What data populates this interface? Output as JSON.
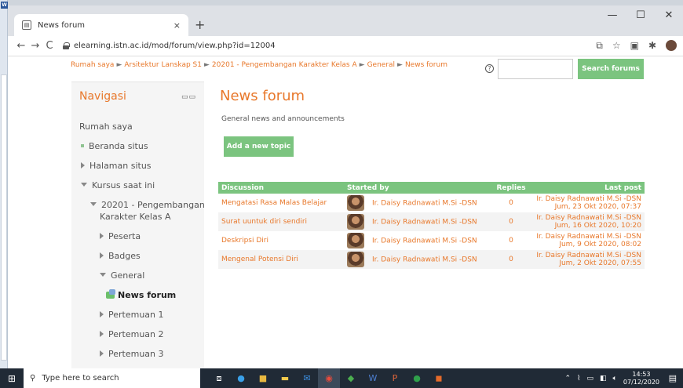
{
  "browser": {
    "tab_title": "News forum",
    "tab_close": "×",
    "new_tab": "+",
    "minimize": "—",
    "maximize": "☐",
    "close": "✕",
    "back": "←",
    "forward": "→",
    "reload": "C",
    "url": "elearning.istn.ac.id/mod/forum/view.php?id=12004"
  },
  "breadcrumb": [
    "Rumah saya",
    "Arsitektur Lanskap S1",
    "20201 - Pengembangan Karakter Kelas A",
    "General",
    "News forum"
  ],
  "breadcrumb_sep": "►",
  "search": {
    "button_label": "Search forums",
    "placeholder": ""
  },
  "sidebar": {
    "title": "Navigasi",
    "items": {
      "rumah": "Rumah saya",
      "beranda": "Beranda situs",
      "halaman": "Halaman situs",
      "kursus": "Kursus saat ini",
      "course_line1": "20201 - Pengembangan",
      "course_line2": "Karakter Kelas A",
      "peserta": "Peserta",
      "badges": "Badges",
      "general": "General",
      "news": "News forum",
      "p1": "Pertemuan 1",
      "p2": "Pertemuan 2",
      "p3": "Pertemuan 3"
    }
  },
  "main": {
    "title": "News forum",
    "description": "General news and announcements",
    "add_topic": "Add a new topic",
    "table": {
      "headers": {
        "discussion": "Discussion",
        "started_by": "Started by",
        "replies": "Replies",
        "last_post": "Last post"
      },
      "rows": [
        {
          "discussion": "Mengatasi Rasa Malas Belajar",
          "started_by": "Ir. Daisy Radnawati M.Si -DSN",
          "replies": "0",
          "last_user": "Ir. Daisy Radnawati M.Si -DSN",
          "last_date": "Jum, 23 Okt 2020, 07:37"
        },
        {
          "discussion": "Surat uuntuk diri sendiri",
          "started_by": "Ir. Daisy Radnawati M.Si -DSN",
          "replies": "0",
          "last_user": "Ir. Daisy Radnawati M.Si -DSN",
          "last_date": "Jum, 16 Okt 2020, 10:20"
        },
        {
          "discussion": "Deskripsi Diri",
          "started_by": "Ir. Daisy Radnawati M.Si -DSN",
          "replies": "0",
          "last_user": "Ir. Daisy Radnawati M.Si -DSN",
          "last_date": "Jum, 9 Okt 2020, 08:02"
        },
        {
          "discussion": "Mengenal Potensi Diri",
          "started_by": "Ir. Daisy Radnawati M.Si -DSN",
          "replies": "0",
          "last_user": "Ir. Daisy Radnawati M.Si -DSN",
          "last_date": "Jum, 2 Okt 2020, 07:55"
        }
      ]
    }
  },
  "taskbar": {
    "search_placeholder": "Type here to search",
    "time": "14:53",
    "date": "07/12/2020"
  },
  "colors": {
    "accent": "#e8782b",
    "green": "#7bc47f",
    "taskbar": "#202a36"
  }
}
